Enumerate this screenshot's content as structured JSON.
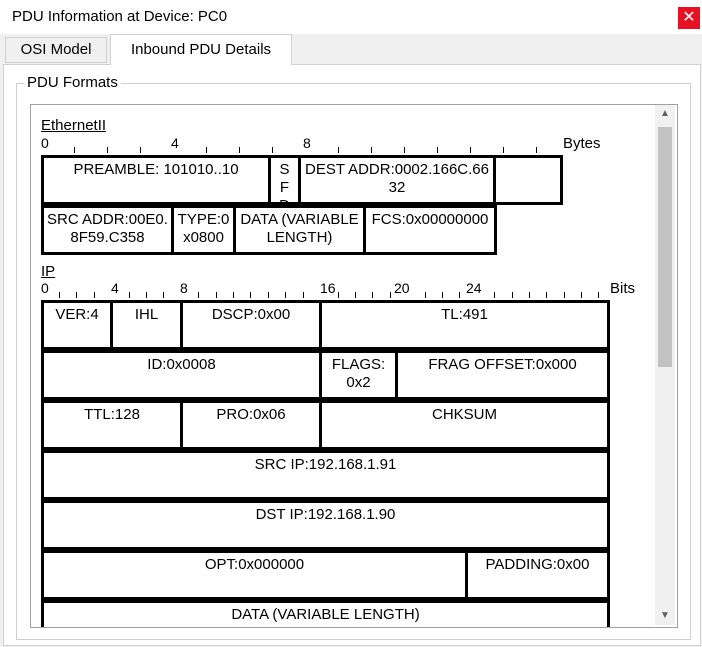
{
  "window": {
    "title": "PDU Information at Device: PC0",
    "close_glyph": "✕"
  },
  "tabs": [
    {
      "label": "OSI Model",
      "active": false
    },
    {
      "label": "Inbound PDU Details",
      "active": true
    }
  ],
  "group": {
    "label": "PDU Formats"
  },
  "ethernet": {
    "title": "EthernetII",
    "ruler": {
      "labels": [
        "0",
        "4",
        "8"
      ],
      "unit": "Bytes"
    },
    "rows": [
      [
        "PREAMBLE: 101010..10",
        "SFD",
        "DEST ADDR:0002.166C.6632",
        ""
      ],
      [
        "SRC ADDR:00E0.8F59.C358",
        "TYPE:0x0800",
        "DATA (VARIABLE LENGTH)",
        "FCS:0x00000000"
      ]
    ]
  },
  "ip": {
    "title": "IP",
    "ruler": {
      "labels": [
        "0",
        "4",
        "8",
        "16",
        "20",
        "24"
      ],
      "unit": "Bits"
    },
    "rows": [
      [
        "VER:4",
        "IHL",
        "DSCP:0x00",
        "TL:491"
      ],
      [
        "ID:0x0008",
        "FLAGS:0x2",
        "FRAG OFFSET:0x000"
      ],
      [
        "TTL:128",
        "PRO:0x06",
        "CHKSUM"
      ],
      [
        "SRC IP:192.168.1.91"
      ],
      [
        "DST IP:192.168.1.90"
      ],
      [
        "OPT:0x000000",
        "PADDING:0x00"
      ],
      [
        "DATA (VARIABLE LENGTH)"
      ]
    ]
  },
  "scrollbar": {
    "up_glyph": "▲",
    "down_glyph": "▼"
  }
}
